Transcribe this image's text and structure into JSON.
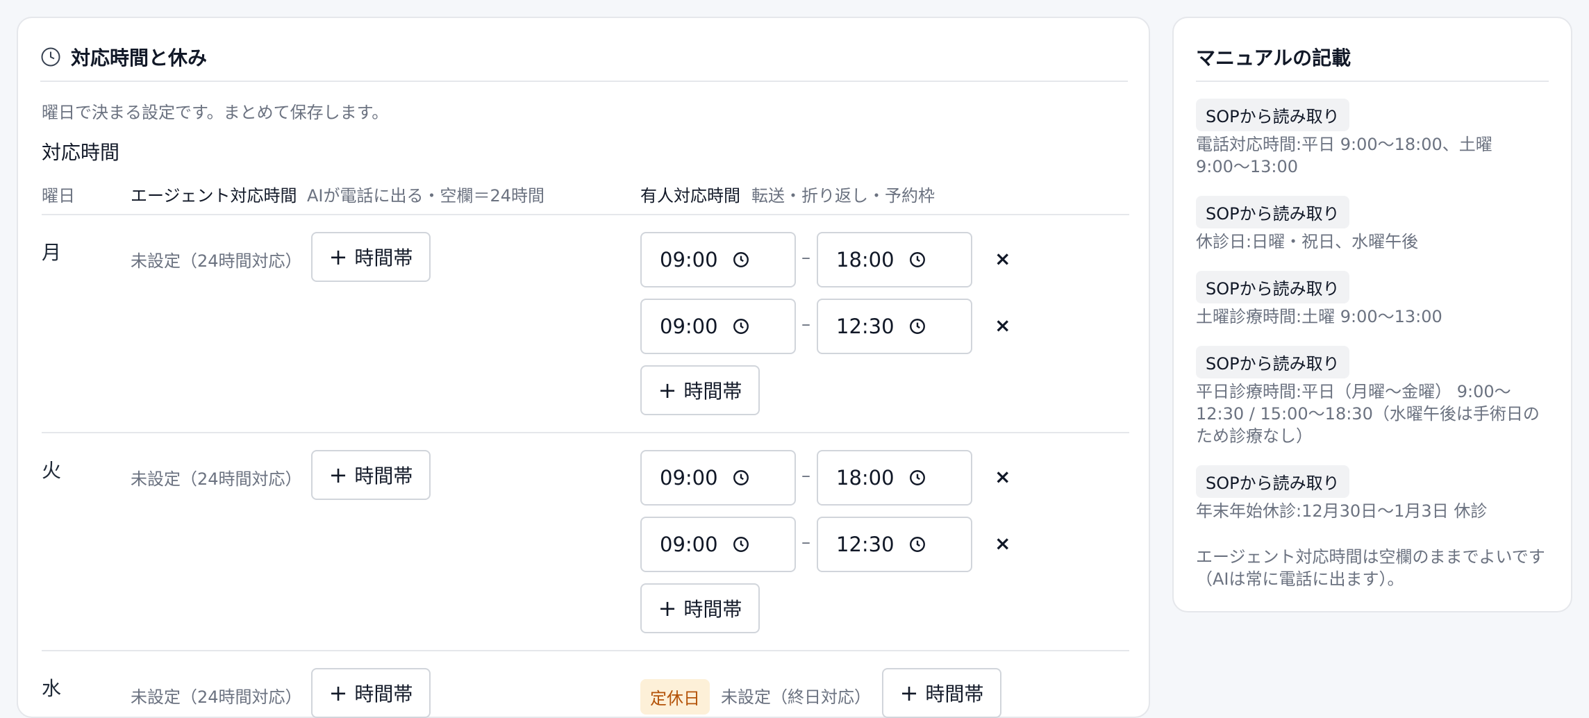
{
  "main": {
    "title": "対応時間と休み",
    "description": "曜日で決まる設定です。まとめて保存します。",
    "section_title": "対応時間",
    "columns": {
      "day": "曜日",
      "agent": "エージェント対応時間",
      "agent_hint": "AIが電話に出る・空欄＝24時間",
      "human": "有人対応時間",
      "human_hint": "転送・折り返し・予約枠"
    },
    "add_slot_label": "時間帯",
    "unset_24h": "未設定（24時間対応）",
    "unset_allday": "未設定（終日対応）",
    "closed_badge": "定休日",
    "days": [
      {
        "label": "月",
        "slots": [
          {
            "start": "09:00",
            "end": "18:00"
          },
          {
            "start": "09:00",
            "end": "12:30"
          }
        ]
      },
      {
        "label": "火",
        "slots": [
          {
            "start": "09:00",
            "end": "18:00"
          },
          {
            "start": "09:00",
            "end": "12:30"
          }
        ]
      },
      {
        "label": "水"
      }
    ]
  },
  "side": {
    "title": "マニュアルの記載",
    "badge": "SOPから読み取り",
    "entries": [
      "電話対応時間:平日 9:00〜18:00、土曜 9:00〜13:00",
      "休診日:日曜・祝日、水曜午後",
      "土曜診療時間:土曜 9:00〜13:00",
      "平日診療時間:平日（月曜〜金曜） 9:00〜12:30 / 15:00〜18:30（水曜午後は手術日のため診療なし）",
      "年末年始休診:12月30日〜1月3日 休診"
    ],
    "note": "エージェント対応時間は空欄のままでよいです（AIは常に電話に出ます）。"
  },
  "icons": {
    "clock": "clock-icon",
    "remove": "close-icon",
    "add": "plus-icon"
  }
}
